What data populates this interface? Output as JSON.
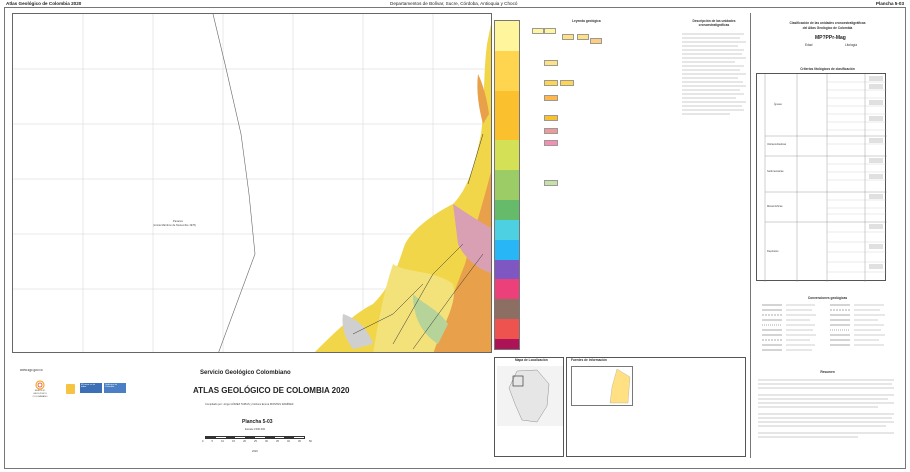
{
  "header": {
    "left": "Atlas Geológico de Colombia 2020",
    "center": "Departamentos de Bolívar, Sucre, Córdoba, Antioquia y Chocó",
    "right": "Plancha 5-03"
  },
  "map": {
    "label_sea": "Panamá",
    "label_sea_sub": "(Límite Marítimo de Noviembre 1976)"
  },
  "title_block": {
    "org": "Servicio Geológico Colombiano",
    "atlas": "ATLAS GEOLÓGICO DE COLOMBIA 2020",
    "compiled": "Compilado por: Jorge GÓMEZ TAPIAS y Nohora Emma MONTES RAMÍREZ",
    "sheet": "Plancha 5-03",
    "scale_label": "Escala 1:500.000",
    "year": "2020",
    "website": "www.sgc.gov.co",
    "scale_ticks": [
      "0",
      "5",
      "10",
      "15",
      "20",
      "25",
      "30",
      "35",
      "40",
      "45",
      "50"
    ]
  },
  "logos": {
    "sgc_line1": "SERVICIO",
    "sgc_line2": "GEOLÓGICO",
    "sgc_line3": "COLOMBIANO",
    "minenergia": "El futuro es de todos",
    "gov": "Gobierno de Colombia"
  },
  "legend": {
    "title": "Leyenda geológica",
    "units_title": "Descripción de las unidades cronoestratigráficas"
  },
  "location": {
    "title": "Mapa de Localización",
    "sources_title": "Fuentes de información"
  },
  "classification": {
    "title_line1": "Clasificación de las unidades cronoestratigráficas",
    "title_line2": "del Atlas Geológico de Colombia",
    "code": "MP?PPr-Mag",
    "age_label": "Edad",
    "lith_label": "Litología",
    "criteria_title": "Criterios litológicos de clasificación",
    "row_labels": [
      "Ígneas",
      "Volcanoclásticas",
      "Sedimentarias",
      "Metamórficas",
      "Depósitos"
    ],
    "rocks_label": "Rocas",
    "lithology_side": "Litología"
  },
  "contacts": {
    "title": "Convenciones geológicas"
  },
  "summary": {
    "title": "Resumen"
  },
  "chart_colors": {
    "sea": "#ffffff",
    "land_yellow": "#f2d64a",
    "land_orange": "#e8a04a",
    "land_pink": "#d9a0b4",
    "land_green": "#b6d39a",
    "land_gray": "#cfcfcf",
    "grid": "#bdbdbd"
  }
}
